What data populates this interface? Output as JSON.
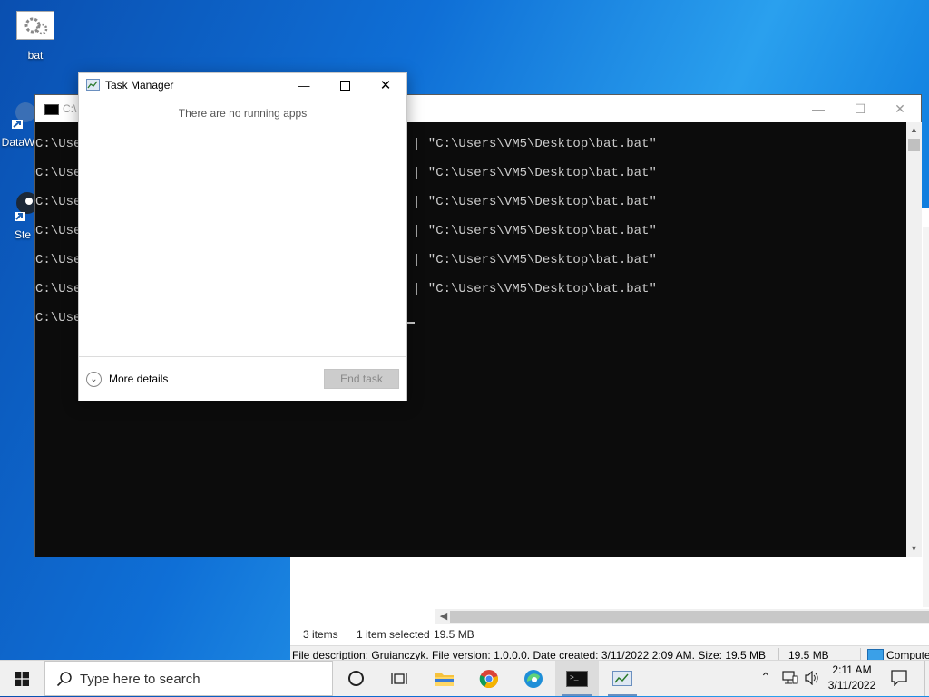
{
  "desktop": {
    "icons": [
      {
        "label": "bat"
      },
      {
        "label": "DataW"
      },
      {
        "label": "Ste"
      }
    ]
  },
  "cmd": {
    "title": "C:\\",
    "lines": [
      {
        "left": "C:\\Use",
        "right": "| \"C:\\Users\\VM5\\Desktop\\bat.bat\""
      },
      {
        "left": "C:\\Use",
        "right": "| \"C:\\Users\\VM5\\Desktop\\bat.bat\""
      },
      {
        "left": "C:\\Use",
        "right": "| \"C:\\Users\\VM5\\Desktop\\bat.bat\""
      },
      {
        "left": "C:\\Use",
        "right": "| \"C:\\Users\\VM5\\Desktop\\bat.bat\""
      },
      {
        "left": "C:\\Use",
        "right": "| \"C:\\Users\\VM5\\Desktop\\bat.bat\""
      },
      {
        "left": "C:\\Use",
        "right": "| \"C:\\Users\\VM5\\Desktop\\bat.bat\""
      },
      {
        "left": "C:\\Use",
        "right": ""
      }
    ]
  },
  "task_manager": {
    "title": "Task Manager",
    "empty_message": "There are no running apps",
    "more_details": "More details",
    "end_task": "End task"
  },
  "explorer": {
    "items_count": "3 items",
    "selected": "1 item selected",
    "selected_size": "19.5 MB",
    "file_description": "File description: Gruianczyk. File version: 1.0.0.0. Date created: 3/11/2022 2:09 AM. Size: 19.5 MB",
    "desc_size": "19.5 MB",
    "desc_location": "Compute"
  },
  "taskbar": {
    "search_placeholder": "Type here to search",
    "time": "2:11 AM",
    "date": "3/11/2022"
  }
}
